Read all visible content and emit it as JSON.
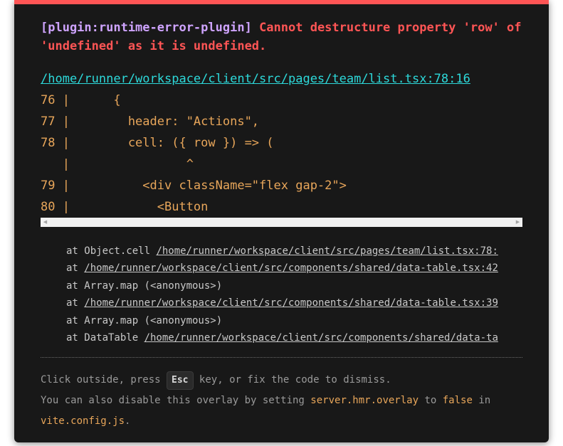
{
  "colors": {
    "accent_red": "#ff5555",
    "plugin_purple": "#cfa4ff",
    "link_cyan": "#2dd9da",
    "code_orange": "#e8a65a",
    "panel_bg": "#181818"
  },
  "error": {
    "plugin": "[plugin:runtime-error-plugin]",
    "message": "Cannot destructure property 'row' of 'undefined' as it is undefined.",
    "file": "/home/runner/workspace/client/src/pages/team/list.tsx:78:16"
  },
  "frame": {
    "lines": [
      "76 |      {",
      "77 |        header: \"Actions\",",
      "78 |        cell: ({ row }) => (",
      "   |                ^",
      "79 |          <div className=\"flex gap-2\">",
      "80 |            <Button"
    ]
  },
  "stack": [
    {
      "prefix": "at Object.cell ",
      "link": "/home/runner/workspace/client/src/pages/team/list.tsx:78:"
    },
    {
      "prefix": "at ",
      "link": "/home/runner/workspace/client/src/components/shared/data-table.tsx:42"
    },
    {
      "prefix": "at Array.map (<anonymous>)",
      "link": ""
    },
    {
      "prefix": "at ",
      "link": "/home/runner/workspace/client/src/components/shared/data-table.tsx:39"
    },
    {
      "prefix": "at Array.map (<anonymous>)",
      "link": ""
    },
    {
      "prefix": "at DataTable ",
      "link": "/home/runner/workspace/client/src/components/shared/data-ta"
    }
  ],
  "tip": {
    "part1": "Click outside, press ",
    "key": "Esc",
    "part2": " key, or fix the code to dismiss.",
    "part3": "You can also disable this overlay by setting ",
    "setting": "server.hmr.overlay",
    "part4": " to ",
    "value": "false",
    "part5": " in ",
    "config_file": "vite.config.js",
    "part6": "."
  },
  "scrollbar": {
    "left_arrow": "◀",
    "right_arrow": "▶"
  }
}
